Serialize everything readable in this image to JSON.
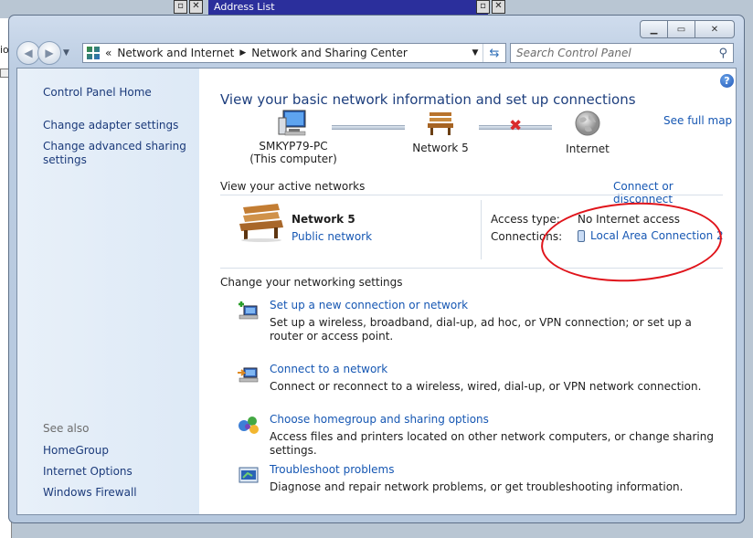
{
  "background": {
    "left_window_text": "io",
    "top_window_title": "Address List"
  },
  "window": {
    "controls": [
      "minimize",
      "maximize",
      "close"
    ]
  },
  "address_bar": {
    "prefix": "«",
    "breadcrumbs": [
      "Network and Internet",
      "Network and Sharing Center"
    ]
  },
  "search": {
    "placeholder": "Search Control Panel"
  },
  "sidebar": {
    "items": [
      {
        "label": "Control Panel Home"
      },
      {
        "label": "Change adapter settings"
      },
      {
        "label": "Change advanced sharing settings"
      }
    ],
    "see_also_label": "See also",
    "see_also": [
      {
        "label": "HomeGroup"
      },
      {
        "label": "Internet Options"
      },
      {
        "label": "Windows Firewall"
      }
    ]
  },
  "main": {
    "title": "View your basic network information and set up connections",
    "see_full_map": "See full map",
    "map": {
      "computer_name": "SMKYP79-PC",
      "computer_sub": "(This computer)",
      "network": "Network  5",
      "internet": "Internet"
    },
    "active_networks_label": "View your active networks",
    "connect_link": "Connect or disconnect",
    "active_network": {
      "name": "Network  5",
      "type": "Public network",
      "access_type_label": "Access type:",
      "access_type_value": "No Internet access",
      "connections_label": "Connections:",
      "connections_value": "Local Area Connection 2"
    },
    "change_settings_label": "Change your networking settings",
    "tasks": [
      {
        "title": "Set up a new connection or network",
        "desc": "Set up a wireless, broadband, dial-up, ad hoc, or VPN connection; or set up a router or access point."
      },
      {
        "title": "Connect to a network",
        "desc": "Connect or reconnect to a wireless, wired, dial-up, or VPN network connection."
      },
      {
        "title": "Choose homegroup and sharing options",
        "desc": "Access files and printers located on other network computers, or change sharing settings."
      },
      {
        "title": "Troubleshoot problems",
        "desc": "Diagnose and repair network problems, or get troubleshooting information."
      }
    ]
  },
  "annotation_color": "#e0141b"
}
